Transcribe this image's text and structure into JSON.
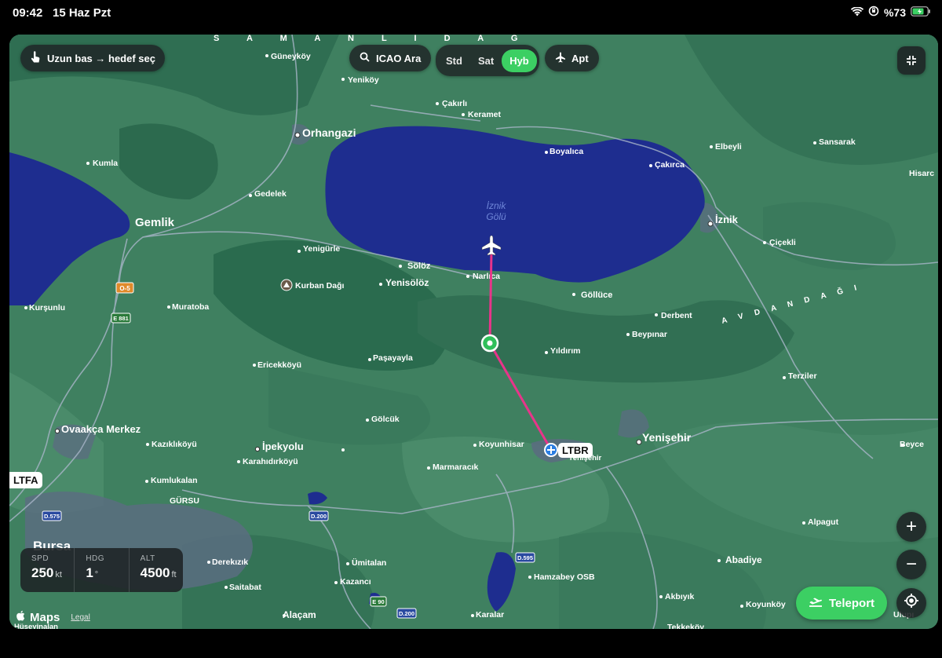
{
  "status_bar": {
    "time": "09:42",
    "date": "15 Haz Pzt",
    "battery": "%73"
  },
  "toolbar": {
    "hint": "Uzun bas → hedef seç",
    "search_label": "ICAO Ara",
    "map_modes": [
      "Std",
      "Sat",
      "Hyb"
    ],
    "active_mode": "Hyb",
    "airports_label": "Apt"
  },
  "map": {
    "lake_label_line1": "İznik",
    "lake_label_line2": "Gölü",
    "mountain_label": "Kurban Dağı",
    "cities": {
      "gemlik": "Gemlik",
      "orhangazi": "Orhangazi",
      "iznik": "İznik",
      "yenisehir": "Yenişehir",
      "bursa": "Bursa",
      "ipekyolu": "İpekyolu",
      "ovaakca": "Ovaakça Merkez"
    },
    "towns": {
      "guneykoy": "Güneyköy",
      "yenikoy": "Yeniköy",
      "cakirli": "Çakırlı",
      "keramet": "Keramet",
      "boyalica": "Boyalıca",
      "elbeyli": "Elbeyli",
      "sansarak": "Sansarak",
      "cakirca": "Çakırca",
      "hisarcik": "Hisarc",
      "kumla": "Kumla",
      "gedelek": "Gedelek",
      "cicekli": "Çiçekli",
      "yenigurle": "Yenigürle",
      "sololoz": "Sölöz",
      "yenisoloz": "Yenisölöz",
      "narlica": "Narlıca",
      "gollüce": "Göllüce",
      "derbent": "Derbent",
      "beypinar": "Beypınar",
      "kursunlu": "Kurşunlu",
      "muratoba": "Muratoba",
      "yildirim": "Yıldırım",
      "pasayayla": "Paşayayla",
      "ericekkoyu": "Ericekköyü",
      "terziler": "Terziler",
      "golcuk": "Gölcük",
      "kazikli": "Kazıklıköyü",
      "karahidir": "Karahıdırköyü",
      "koyunhisar": "Koyunhisar",
      "marmaracik": "Marmaracık",
      "beyce": "Beyce",
      "kumlukalan": "Kumlukalan",
      "gursu": "GÜRSU",
      "alpagut": "Alpagut",
      "derekizik": "Derekızık",
      "umitalan": "Ümitalan",
      "abadiye": "Abadiye",
      "hamzabey": "Hamzabey OSB",
      "kazanci": "Kazancı",
      "saitabat": "Saitabat",
      "akbiyik": "Akbıyık",
      "koyunkoy": "Koyunköy",
      "alacam": "Alaçam",
      "karalar": "Karalar",
      "tekkekoy": "Tekkeköy",
      "ulupinar": "Ulupı",
      "yenisehir_apt": "Yenişehir",
      "huseyinalan": "Hüseyinalan"
    },
    "ridge_top": "S A M A N L I  D A Ğ",
    "ridge_avdan": "A V D A N  D A Ğ I",
    "road_shields": {
      "o5": "O-5",
      "e881": "E 881",
      "d575": "D.575",
      "d200a": "D.200",
      "d595": "D.595",
      "e90": "E 90",
      "d200b": "D.200"
    },
    "route_color": "#e8348a",
    "water_color": "#1e2d8f"
  },
  "airports": {
    "ltfa": "LTFA",
    "ltbr": "LTBR"
  },
  "telemetry": {
    "spd_label": "SPD",
    "spd_value": "250",
    "spd_unit": "kt",
    "hdg_label": "HDG",
    "hdg_value": "1",
    "hdg_unit": "°",
    "alt_label": "ALT",
    "alt_value": "4500",
    "alt_unit": "ft"
  },
  "controls": {
    "zoom_in": "+",
    "zoom_out": "−",
    "teleport_label": "Teleport"
  },
  "attribution": {
    "brand": "Maps",
    "legal": "Legal"
  }
}
